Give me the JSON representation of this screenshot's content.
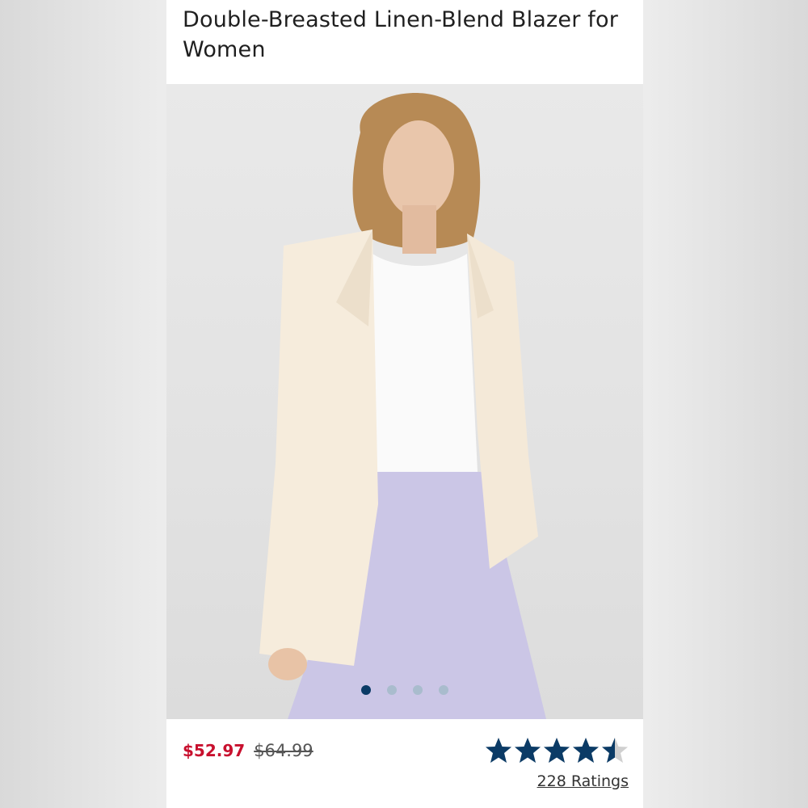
{
  "product": {
    "title": "Double-Breasted Linen-Blend Blazer for Women",
    "price_sale": "$52.97",
    "price_original": "$64.99",
    "rating_value": 4.5,
    "rating_max": 5,
    "ratings_count_text": "228 Ratings"
  },
  "carousel": {
    "slide_count": 4,
    "active_index": 0
  },
  "colors": {
    "sale_price": "#c8102e",
    "star": "#0b3b66",
    "dot_active": "#0b3b66",
    "dot_inactive": "#a9bccd"
  }
}
